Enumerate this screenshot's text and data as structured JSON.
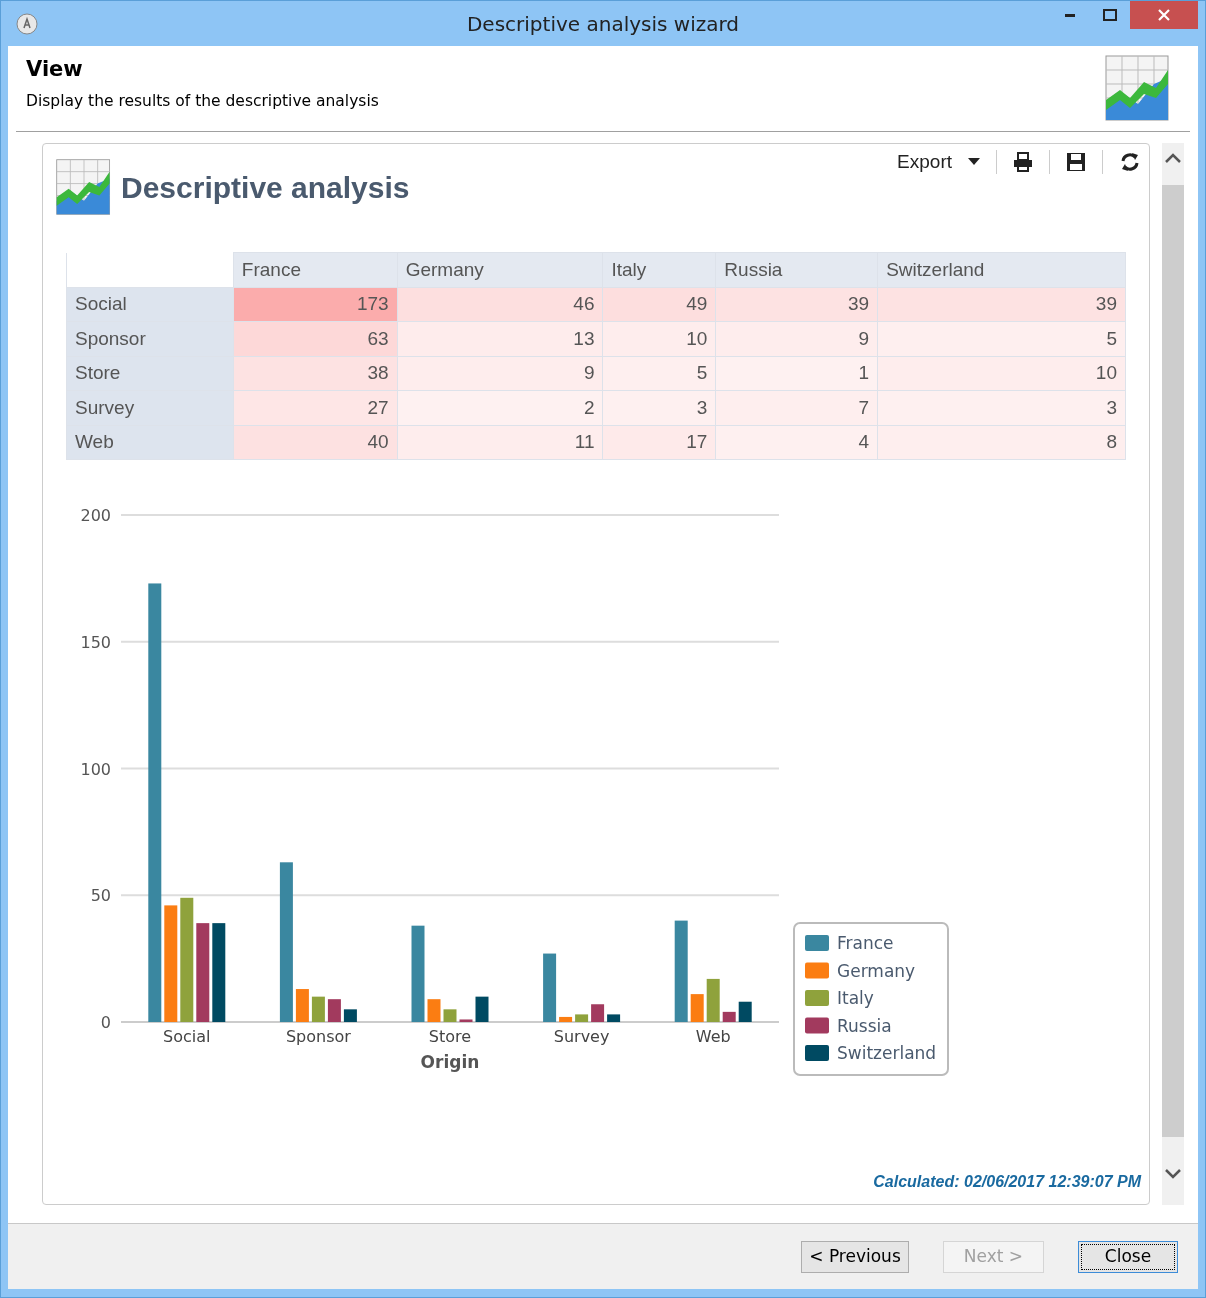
{
  "window": {
    "title": "Descriptive analysis wizard"
  },
  "header": {
    "title": "View",
    "subtitle": "Display the results of the descriptive analysis"
  },
  "report": {
    "title": "Descriptive analysis",
    "export_label": "Export",
    "table": {
      "columns": [
        "France",
        "Germany",
        "Italy",
        "Russia",
        "Switzerland"
      ],
      "rows": [
        {
          "label": "Social",
          "values": [
            "173",
            "46",
            "49",
            "39",
            "39"
          ]
        },
        {
          "label": "Sponsor",
          "values": [
            "63",
            "13",
            "10",
            "9",
            "5"
          ]
        },
        {
          "label": "Store",
          "values": [
            "38",
            "9",
            "5",
            "1",
            "10"
          ]
        },
        {
          "label": "Survey",
          "values": [
            "27",
            "2",
            "3",
            "7",
            "3"
          ]
        },
        {
          "label": "Web",
          "values": [
            "40",
            "11",
            "17",
            "4",
            "8"
          ]
        }
      ]
    },
    "chart_data": {
      "type": "bar",
      "xlabel": "Origin",
      "categories": [
        "Social",
        "Sponsor",
        "Store",
        "Survey",
        "Web"
      ],
      "series": [
        {
          "name": "France",
          "color": "#3a87a0",
          "values": [
            173,
            63,
            38,
            27,
            40
          ]
        },
        {
          "name": "Germany",
          "color": "#fb7d12",
          "values": [
            46,
            13,
            9,
            2,
            11
          ]
        },
        {
          "name": "Italy",
          "color": "#8fa23c",
          "values": [
            49,
            10,
            5,
            3,
            17
          ]
        },
        {
          "name": "Russia",
          "color": "#a23a5e",
          "values": [
            39,
            9,
            1,
            7,
            4
          ]
        },
        {
          "name": "Switzerland",
          "color": "#004a62",
          "values": [
            39,
            5,
            10,
            3,
            8
          ]
        }
      ],
      "ylim": [
        0,
        200
      ],
      "yticks": [
        0,
        50,
        100,
        150,
        200
      ],
      "grid": true,
      "legend": true
    },
    "calculated": "Calculated: 02/06/2017 12:39:07 PM"
  },
  "buttons": [
    {
      "label": "< Previous",
      "disabled": false,
      "focused": false
    },
    {
      "label": "Next >",
      "disabled": true,
      "focused": false
    },
    {
      "label": "Close",
      "disabled": false,
      "focused": true
    }
  ]
}
